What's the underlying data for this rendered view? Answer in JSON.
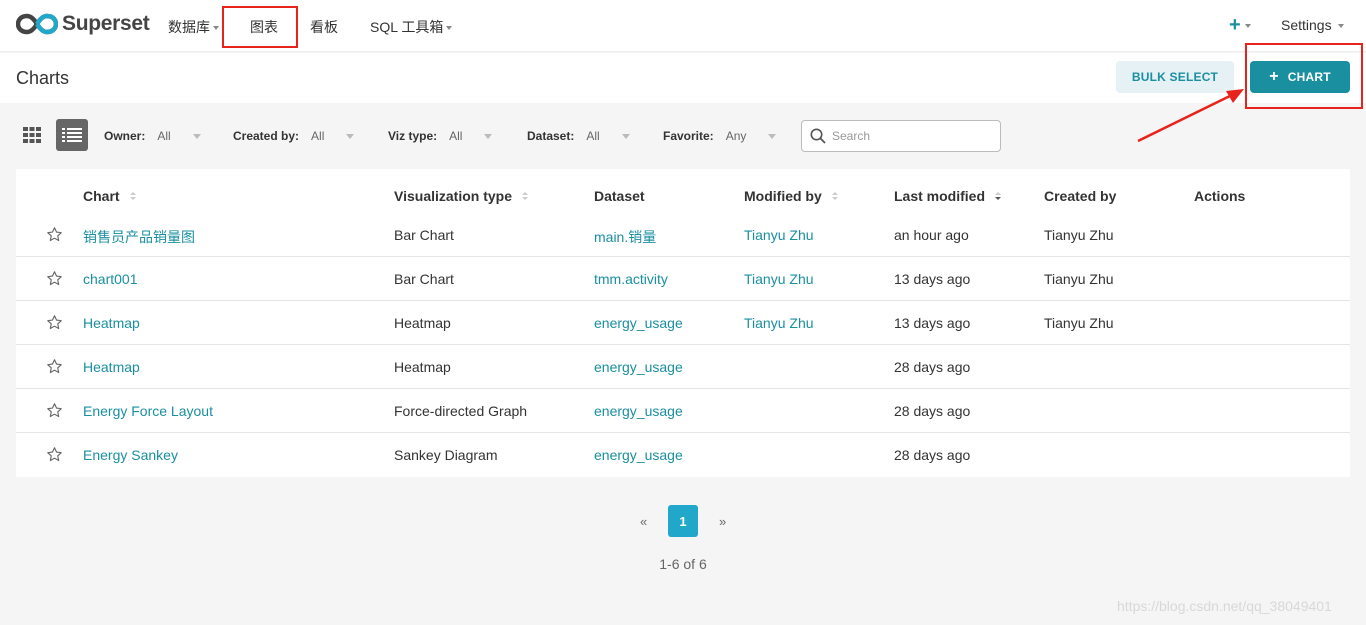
{
  "app": {
    "name": "Superset"
  },
  "nav": {
    "items": [
      "数据库",
      "图表",
      "看板",
      "SQL 工具箱"
    ],
    "plus_label": "+",
    "settings_label": "Settings"
  },
  "header": {
    "title": "Charts",
    "bulk_select_label": "BULK SELECT",
    "add_chart_label": "CHART"
  },
  "filters": [
    {
      "label": "Owner:",
      "value": "All"
    },
    {
      "label": "Created by:",
      "value": "All"
    },
    {
      "label": "Viz type:",
      "value": "All"
    },
    {
      "label": "Dataset:",
      "value": "All"
    },
    {
      "label": "Favorite:",
      "value": "Any"
    }
  ],
  "search": {
    "placeholder": "Search"
  },
  "table": {
    "columns": [
      "Chart",
      "Visualization type",
      "Dataset",
      "Modified by",
      "Last modified",
      "Created by",
      "Actions"
    ],
    "rows": [
      {
        "chart": "销售员产品销量图",
        "viz": "Bar Chart",
        "dataset": "main.销量",
        "modified_by": "Tianyu Zhu",
        "last_modified": "an hour ago",
        "created_by": "Tianyu Zhu"
      },
      {
        "chart": "chart001",
        "viz": "Bar Chart",
        "dataset": "tmm.activity",
        "modified_by": "Tianyu Zhu",
        "last_modified": "13 days ago",
        "created_by": "Tianyu Zhu"
      },
      {
        "chart": "Heatmap",
        "viz": "Heatmap",
        "dataset": "energy_usage",
        "modified_by": "Tianyu Zhu",
        "last_modified": "13 days ago",
        "created_by": "Tianyu Zhu"
      },
      {
        "chart": "Heatmap",
        "viz": "Heatmap",
        "dataset": "energy_usage",
        "modified_by": "",
        "last_modified": "28 days ago",
        "created_by": ""
      },
      {
        "chart": "Energy Force Layout",
        "viz": "Force-directed Graph",
        "dataset": "energy_usage",
        "modified_by": "",
        "last_modified": "28 days ago",
        "created_by": ""
      },
      {
        "chart": "Energy Sankey",
        "viz": "Sankey Diagram",
        "dataset": "energy_usage",
        "modified_by": "",
        "last_modified": "28 days ago",
        "created_by": ""
      }
    ]
  },
  "pagination": {
    "prev": "«",
    "current": "1",
    "next": "»",
    "summary": "1-6 of 6"
  },
  "watermark": "https://blog.csdn.net/qq_38049401",
  "colors": {
    "accent": "#1a8fa0",
    "page_active": "#20a7c9",
    "annotation_red": "#e8231b"
  }
}
